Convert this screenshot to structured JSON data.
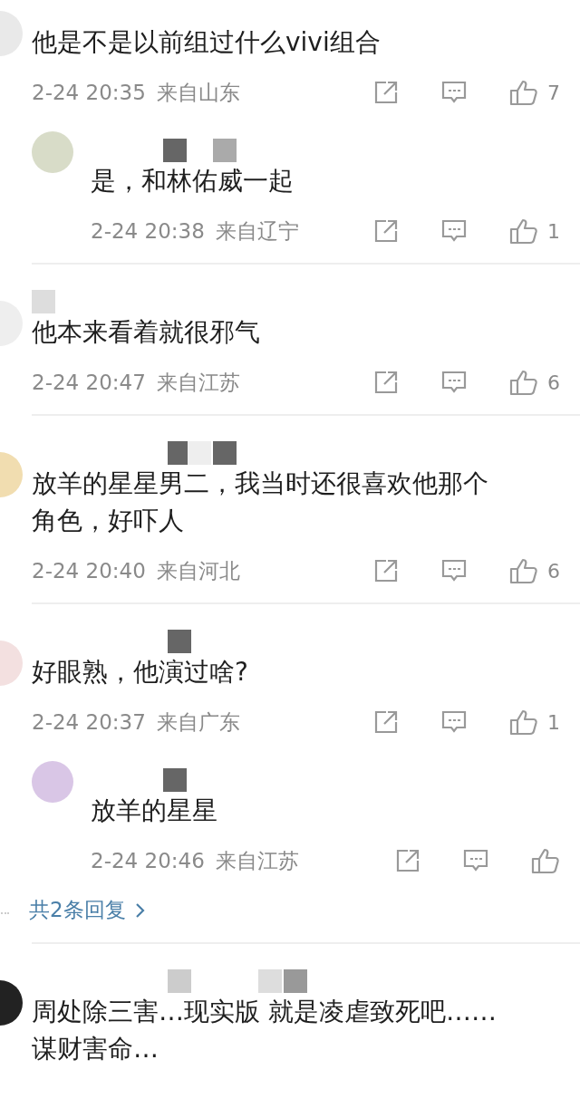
{
  "comments": [
    {
      "kind": "top",
      "text": "他是不是以前组过什么vivi组合",
      "time": "2-24 20:35",
      "location": "来自山东",
      "likes": "7",
      "replies": [
        {
          "text": "是，和林佑威一起",
          "time": "2-24 20:38",
          "location": "来自辽宁",
          "likes": "1"
        }
      ]
    },
    {
      "kind": "top",
      "text": "他本来看着就很邪气",
      "time": "2-24 20:47",
      "location": "来自江苏",
      "likes": "6"
    },
    {
      "kind": "top",
      "text": "放羊的星星男二，我当时还很喜欢他那个角色，好吓人",
      "time": "2-24 20:40",
      "location": "来自河北",
      "likes": "6"
    },
    {
      "kind": "top",
      "text": "好眼熟，他演过啥?",
      "time": "2-24 20:37",
      "location": "来自广东",
      "likes": "1",
      "replies": [
        {
          "text": "放羊的星星",
          "time": "2-24 20:46",
          "location": "来自江苏"
        }
      ],
      "more_replies": "共2条回复"
    },
    {
      "kind": "top",
      "text": "周处除三害…现实版 就是凌虐致死吧……谋财害命…"
    }
  ]
}
